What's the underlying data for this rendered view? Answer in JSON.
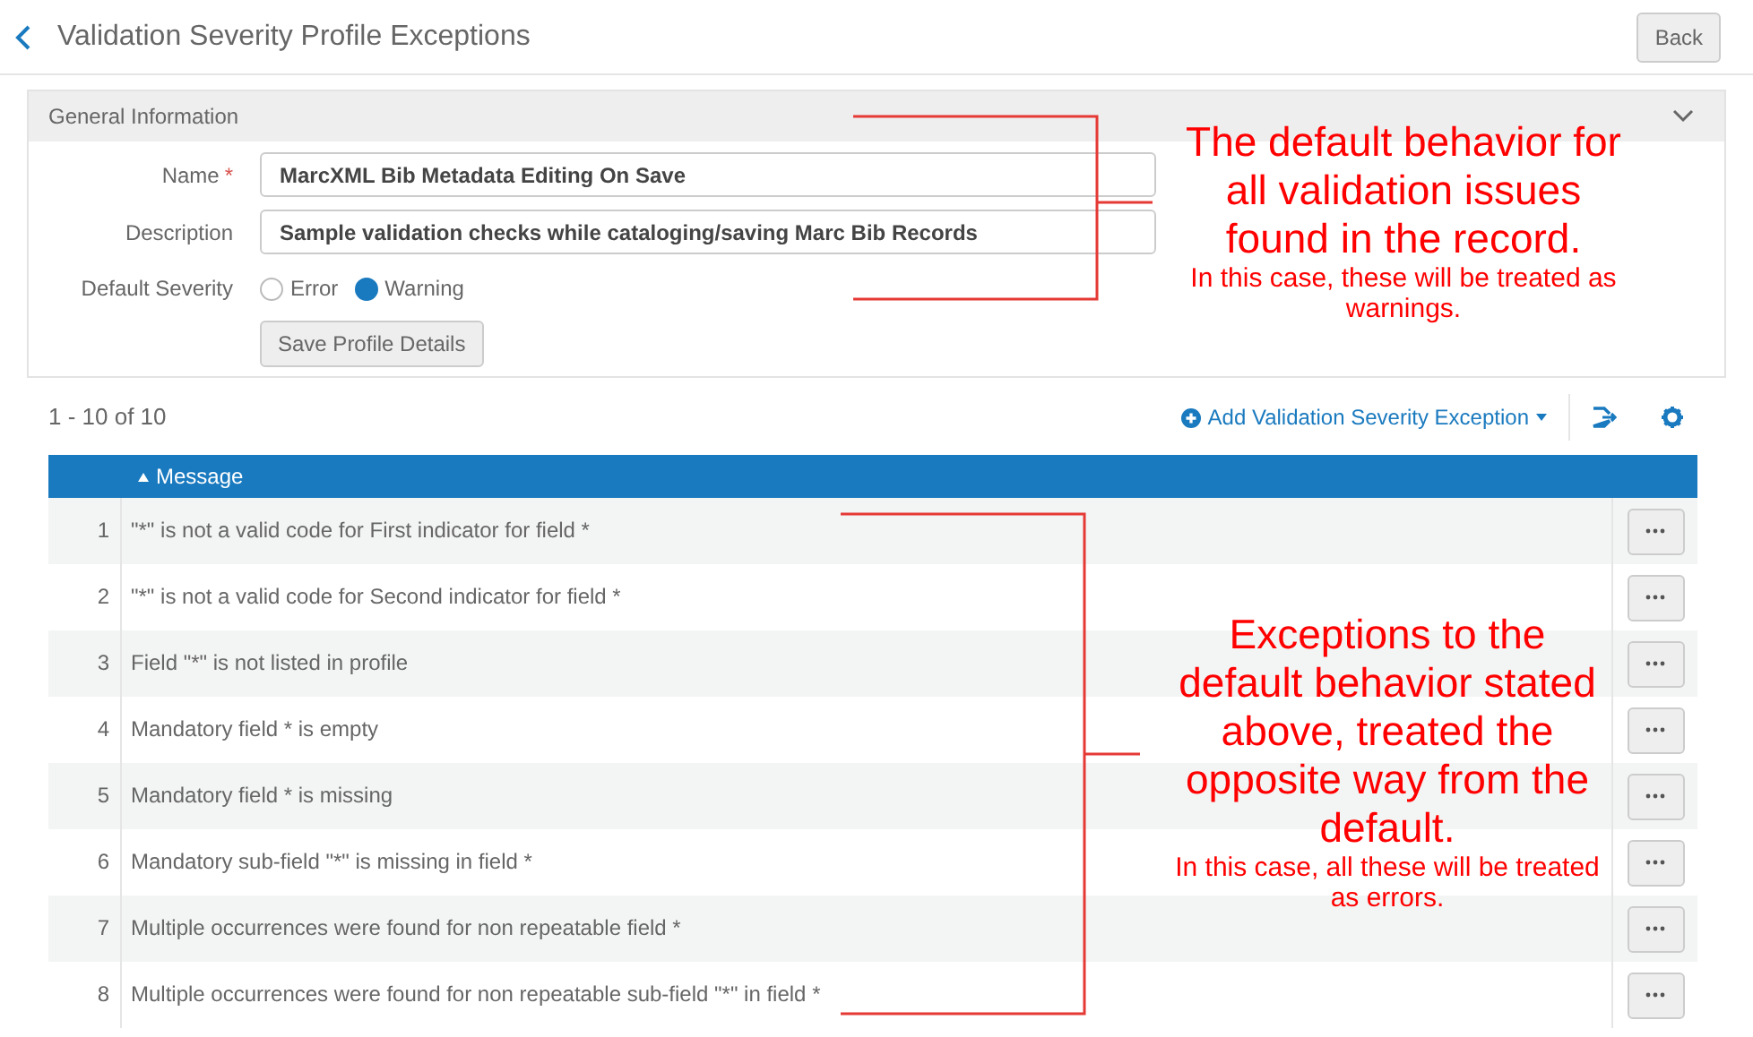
{
  "page": {
    "title": "Validation Severity Profile Exceptions",
    "back_button": "Back"
  },
  "general_information": {
    "title": "General Information",
    "fields": [
      {
        "label": "Name",
        "required_marker": "*",
        "value": "MarcXML Bib Metadata Editing On Save"
      },
      {
        "label": "Description",
        "value": "Sample validation checks while cataloging/saving Marc Bib Records"
      }
    ],
    "default_severity": {
      "label": "Default Severity",
      "options": [
        {
          "label": "Error",
          "selected": false
        },
        {
          "label": "Warning",
          "selected": true
        }
      ]
    },
    "save_button": "Save Profile Details"
  },
  "results": {
    "count": "1 - 10 of 10",
    "add_button": "Add Validation Severity Exception"
  },
  "table": {
    "columns": [
      "Message"
    ],
    "rows": [
      {
        "number": "1",
        "message": "\"*\" is not a valid code for First indicator for field *"
      },
      {
        "number": "2",
        "message": "\"*\" is not a valid code for Second indicator for field *"
      },
      {
        "number": "3",
        "message": "Field \"*\" is not listed in profile"
      },
      {
        "number": "4",
        "message": "Mandatory field * is empty"
      },
      {
        "number": "5",
        "message": "Mandatory field * is missing"
      },
      {
        "number": "6",
        "message": "Mandatory sub-field \"*\" is missing in field *"
      },
      {
        "number": "7",
        "message": "Multiple occurrences were found for non repeatable field *"
      },
      {
        "number": "8",
        "message": "Multiple occurrences were found for non repeatable sub-field \"*\" in field *"
      }
    ]
  },
  "annotations": [
    {
      "heading": "The default behavior for all validation issues found in the record.",
      "note": "In this case, these will be treated as warnings."
    },
    {
      "heading": "Exceptions to the default behavior stated above, treated the opposite way from the default.",
      "note": "In this case, all these will be treated as errors."
    }
  ]
}
